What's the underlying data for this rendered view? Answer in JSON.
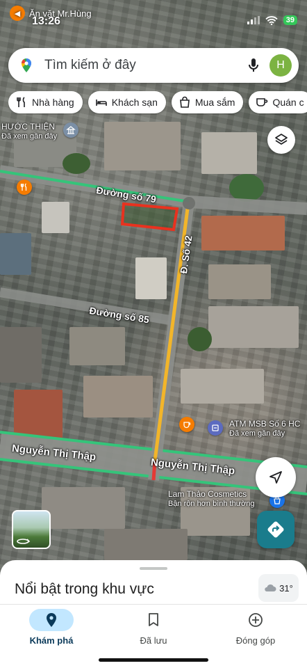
{
  "status_bar": {
    "back_app": "Ăn vặt Mr.Hùng",
    "time": "13:26",
    "battery": "39"
  },
  "search": {
    "placeholder": "Tìm kiếm ở đây",
    "avatar_letter": "H"
  },
  "chips": [
    {
      "label": "Nhà hàng",
      "icon": "fork-knife-icon"
    },
    {
      "label": "Khách sạn",
      "icon": "bed-icon"
    },
    {
      "label": "Mua sắm",
      "icon": "shopping-bag-icon"
    },
    {
      "label": "Quán c",
      "icon": "coffee-cup-icon"
    }
  ],
  "map": {
    "streets": {
      "duong_so_79": "Đường số 79",
      "d_so_42": "Đ. Số 42",
      "duong_so_85": "Đường số 85",
      "nguyen_thi_thap_left": "Nguyễn Thị Thập",
      "nguyen_thi_thap_right": "Nguyễn Thị Thập"
    },
    "places": {
      "church_name": "HƯỚC THIỆN",
      "church_status": "Đã xem gần đây",
      "atm_name": "ATM MSB Số 6 HC",
      "atm_status": "Đã xem gần đây",
      "cosmetics_name": "Lam Thảo Cosmetics",
      "cosmetics_status": "Bận rộn hơn bình thường"
    },
    "accent_colors": {
      "highlight_box": "#e8321f",
      "route": "#f2b52a",
      "main_road": "#35c47a"
    }
  },
  "sheet": {
    "title": "Nổi bật trong khu vực",
    "temperature": "31°"
  },
  "nav": {
    "explore": "Khám phá",
    "saved": "Đã lưu",
    "contribute": "Đóng góp"
  }
}
